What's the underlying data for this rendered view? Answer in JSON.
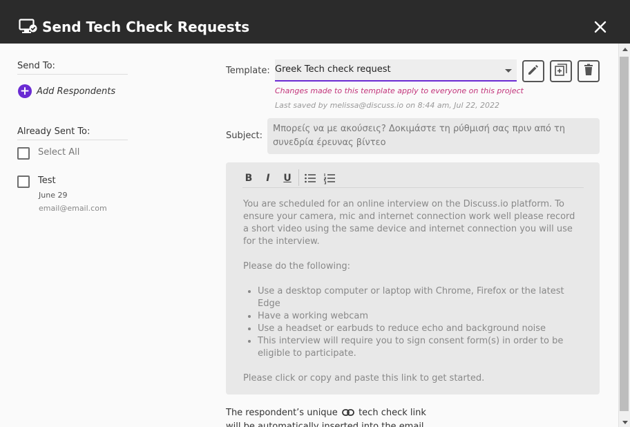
{
  "header": {
    "title": "Send Tech Check Requests",
    "title_icon": "monitor-check-icon",
    "close_icon": "close-icon"
  },
  "left": {
    "send_to_label": "Send To:",
    "add_respondents_label": "Add Respondents",
    "already_sent_label": "Already Sent To:",
    "select_all_label": "Select All",
    "respondents": [
      {
        "name": "Test",
        "date": "June 29",
        "email": "email@email.com"
      }
    ]
  },
  "template": {
    "label": "Template:",
    "selected": "Greek Tech check request",
    "warning": "Changes made to this template apply to everyone on this project",
    "last_saved": "Last saved by melissa@discuss.io on 8:44 am, Jul 22, 2022",
    "actions": [
      "edit-icon",
      "duplicate-icon",
      "delete-icon"
    ]
  },
  "subject": {
    "label": "Subject:",
    "value": "Μπορείς να με ακούσεις? Δοκιμάστε τη ρύθμισή σας πριν από τη συνεδρία έρευνας βίντεο"
  },
  "editor": {
    "toolbar": {
      "bold": "B",
      "italic": "I",
      "underline": "U"
    },
    "intro": "You are scheduled for an online interview on the Discuss.io platform. To ensure your camera, mic and internet connection work well please record a short video using the same device and internet connection you will use for the interview.",
    "instructions": "Please do the following:",
    "bullets": [
      "Use a desktop computer or laptop with Chrome, Firefox or the latest Edge",
      "Have a working webcam",
      "Use a headset or earbuds to reduce echo and background noise",
      "This interview will require you to sign consent form(s) in order to be eligible to participate."
    ],
    "closing": "Please click or copy and paste this link to get started."
  },
  "footer": {
    "line1_before": "The respondent’s unique",
    "line1_after": "tech check link",
    "line2": "will be automatically inserted into the email."
  },
  "colors": {
    "accent": "#6a2bd3",
    "warning": "#c2337a",
    "header_bg": "#2b2b2b"
  }
}
